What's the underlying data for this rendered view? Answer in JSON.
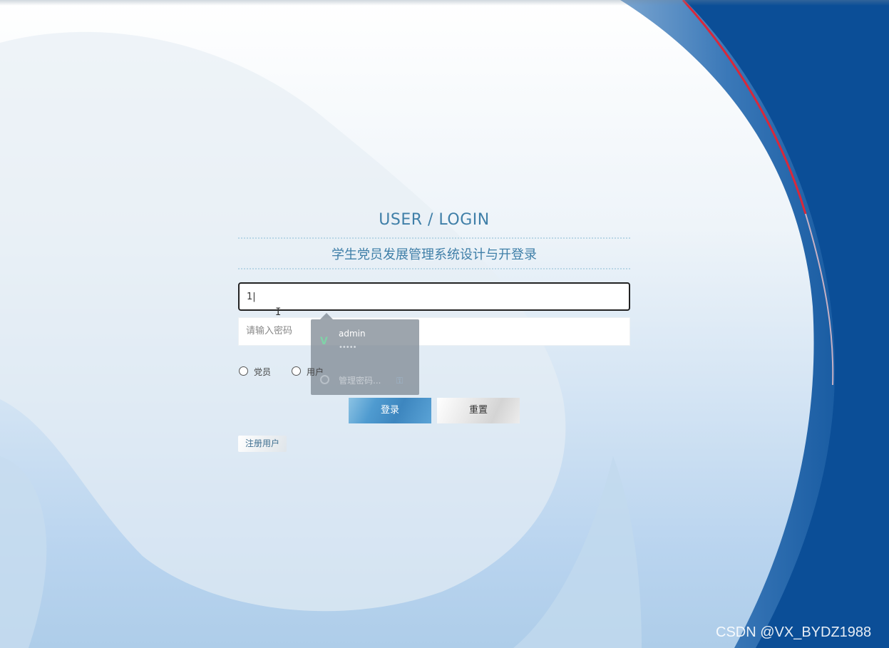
{
  "login": {
    "title": "USER / LOGIN",
    "system_name": "学生党员发展管理系统设计与开登录",
    "username_value": "1|",
    "password_placeholder": "请输入密码",
    "roles": [
      "党员",
      "用户"
    ],
    "login_button": "登录",
    "reset_button": "重置",
    "register_link": "注册用户"
  },
  "autofill": {
    "username": "admin",
    "password_mask": "•••••",
    "manage_label": "管理密码..."
  },
  "watermark": "CSDN @VX_BYDZ1988",
  "colors": {
    "accent": "#3f7fa8",
    "sidebar_blue": "#0b4e97",
    "login_button": "#4f9bd0"
  },
  "icons": {
    "autofill_app": "vue-icon",
    "manage": "chrome-icon",
    "key": "key-icon"
  }
}
